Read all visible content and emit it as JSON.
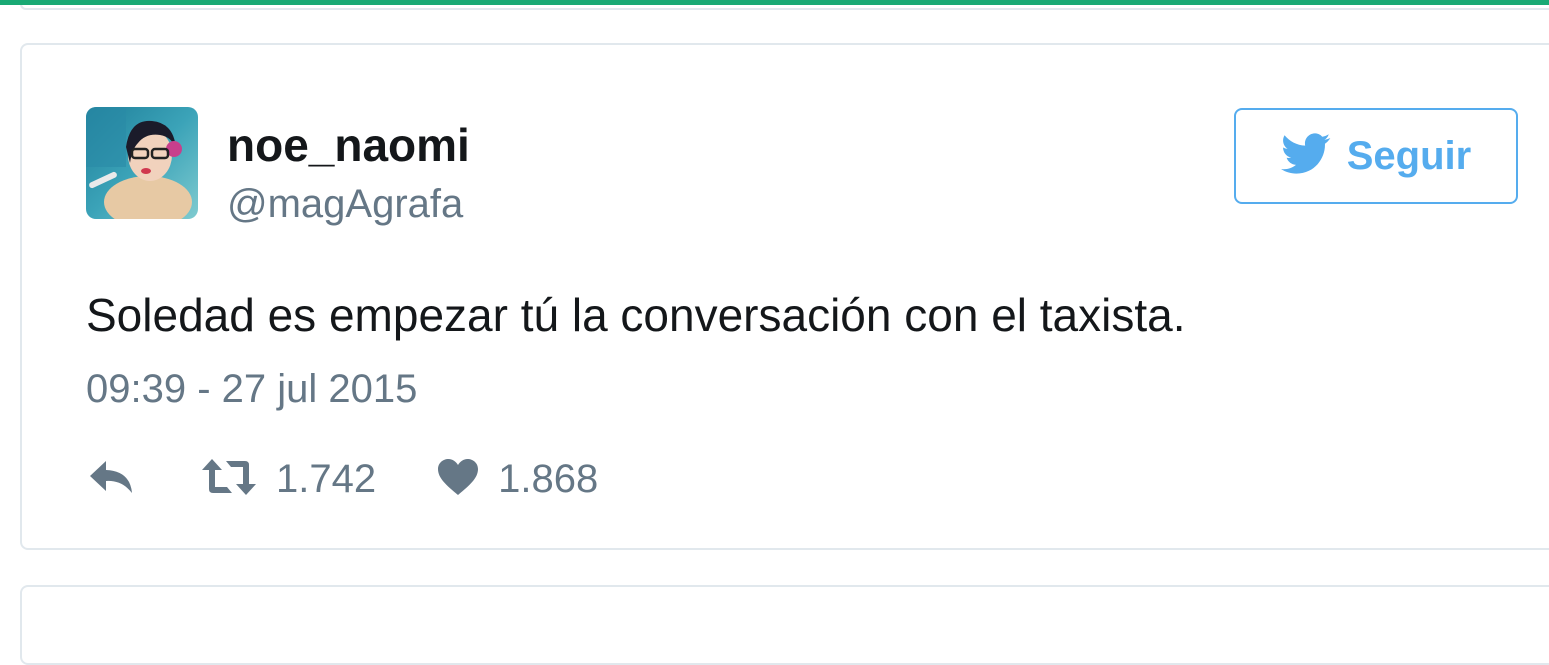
{
  "tweet": {
    "display_name": "noe_naomi",
    "handle": "@magAgrafa",
    "follow_label": "Seguir",
    "text": "Soledad es empezar tú la conversación con el taxista.",
    "timestamp": "09:39 - 27 jul 2015",
    "retweets": "1.742",
    "likes": "1.868"
  },
  "icons": {
    "brand": "twitter-bird-icon",
    "reply": "reply-icon",
    "retweet": "retweet-icon",
    "like": "heart-icon"
  },
  "colors": {
    "accent_bar": "#19a974",
    "brand_blue": "#55acee",
    "text_primary": "#14171a",
    "text_secondary": "#657786",
    "border": "#e1e8ed"
  }
}
